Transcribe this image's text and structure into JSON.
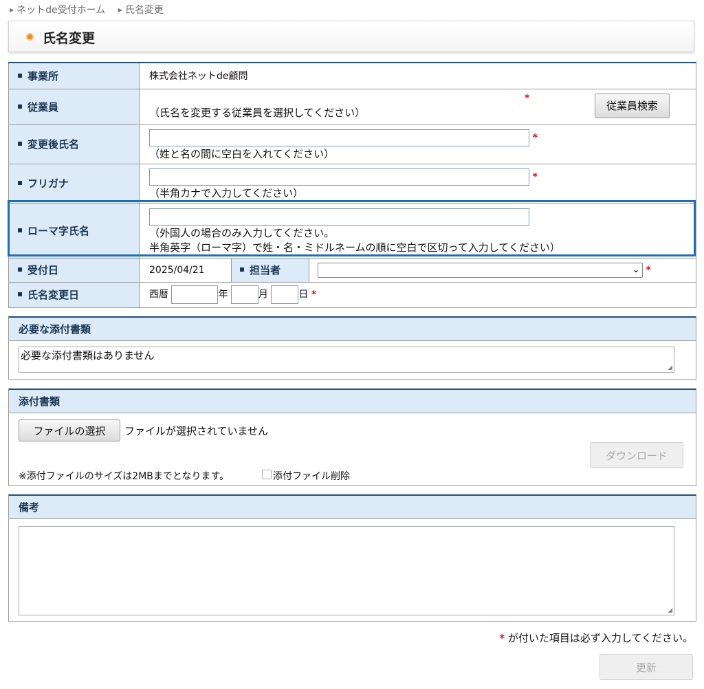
{
  "breadcrumb": [
    "ネットde受付ホーム",
    "氏名変更"
  ],
  "page_title": "氏名変更",
  "form": {
    "office_label": "事業所",
    "office_value": "株式会社ネットde顧問",
    "employee_label": "従業員",
    "employee_hint": "（氏名を変更する従業員を選択してください）",
    "employee_search_button": "従業員検索",
    "new_name_label": "変更後氏名",
    "new_name_value": "",
    "new_name_hint": "（姓と名の間に空白を入れてください）",
    "furigana_label": "フリガナ",
    "furigana_value": "",
    "furigana_hint": "（半角カナで入力してください）",
    "roman_label": "ローマ字氏名",
    "roman_value": "",
    "roman_hint_1": "（外国人の場合のみ入力してください。",
    "roman_hint_2": "半角英字（ローマ字）で姓・名・ミドルネームの順に空白で区切って入力してください）",
    "received_label": "受付日",
    "received_value": "2025/04/21",
    "staff_label": "担当者",
    "staff_value": "",
    "change_date_label": "氏名変更日",
    "era": "西暦",
    "year_unit": "年",
    "month_unit": "月",
    "day_unit": "日",
    "required_mark": "*"
  },
  "required_docs": {
    "title": "必要な添付書類",
    "text": "必要な添付書類はありません"
  },
  "attachments": {
    "title": "添付書類",
    "file_button": "ファイルの選択",
    "file_status": "ファイルが選択されていません",
    "download_button": "ダウンロード",
    "note": "※添付ファイルのサイズは2MBまでとなります。",
    "delete_label": "添付ファイル削除"
  },
  "remarks": {
    "title": "備考",
    "value": ""
  },
  "footer": {
    "required_note": "が付いた項目は必ず入力してください。",
    "update_button": "更新"
  }
}
